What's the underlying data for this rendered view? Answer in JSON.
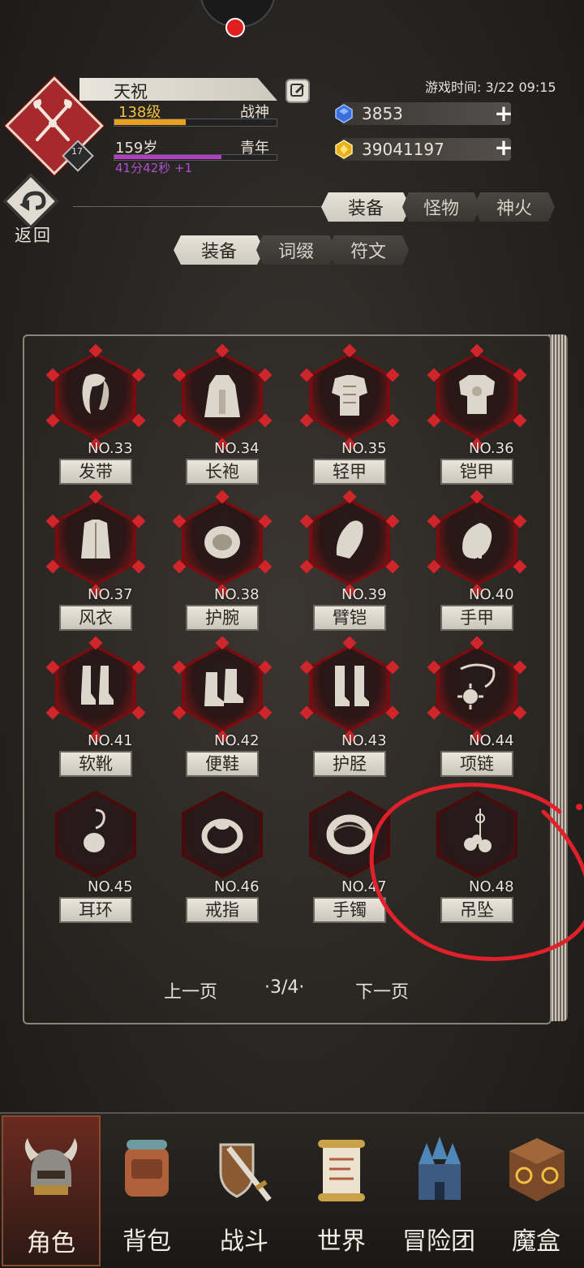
{
  "header": {
    "name": "天祝",
    "level": "138级",
    "title": "战神",
    "age": "159岁",
    "stage": "青年",
    "timer": "41分42秒 +1",
    "avatar_level": "17",
    "game_time": "游戏时间: 3/22 09:15",
    "xp_progress": 0.44,
    "age_progress": 0.66
  },
  "resources": [
    {
      "icon": "blue-gem-icon",
      "value": "3853",
      "color": "#3a6fe0"
    },
    {
      "icon": "gold-coin-icon",
      "value": "39041197",
      "color": "#e8b020"
    }
  ],
  "back_label": "返回",
  "main_tabs": [
    {
      "label": "装备",
      "active": true
    },
    {
      "label": "怪物",
      "active": false
    },
    {
      "label": "神火",
      "active": false
    }
  ],
  "sub_tabs": [
    {
      "label": "装备",
      "active": true
    },
    {
      "label": "词缀",
      "active": false
    },
    {
      "label": "符文",
      "active": false
    }
  ],
  "items": [
    {
      "no": "NO.33",
      "label": "发带"
    },
    {
      "no": "NO.34",
      "label": "长袍"
    },
    {
      "no": "NO.35",
      "label": "轻甲"
    },
    {
      "no": "NO.36",
      "label": "铠甲"
    },
    {
      "no": "NO.37",
      "label": "风衣"
    },
    {
      "no": "NO.38",
      "label": "护腕"
    },
    {
      "no": "NO.39",
      "label": "臂铠"
    },
    {
      "no": "NO.40",
      "label": "手甲"
    },
    {
      "no": "NO.41",
      "label": "软靴"
    },
    {
      "no": "NO.42",
      "label": "便鞋"
    },
    {
      "no": "NO.43",
      "label": "护胫"
    },
    {
      "no": "NO.44",
      "label": "项链"
    },
    {
      "no": "NO.45",
      "label": "耳环"
    },
    {
      "no": "NO.46",
      "label": "戒指"
    },
    {
      "no": "NO.47",
      "label": "手镯"
    },
    {
      "no": "NO.48",
      "label": "吊坠"
    }
  ],
  "pager": {
    "prev": "上一页",
    "page": "·3/4·",
    "next": "下一页"
  },
  "nav": [
    {
      "label": "角色",
      "icon": "helmet-icon",
      "active": true
    },
    {
      "label": "背包",
      "icon": "backpack-icon",
      "active": false
    },
    {
      "label": "战斗",
      "icon": "sword-shield-icon",
      "active": false
    },
    {
      "label": "世界",
      "icon": "scroll-map-icon",
      "active": false
    },
    {
      "label": "冒险团",
      "icon": "castle-icon",
      "active": false
    },
    {
      "label": "魔盒",
      "icon": "magic-box-icon",
      "active": false
    }
  ],
  "colors": {
    "accent_red": "#c81e24",
    "annotation_red": "#e0202a",
    "level_gold": "#f0c040",
    "timer_purple": "#b050d0"
  }
}
